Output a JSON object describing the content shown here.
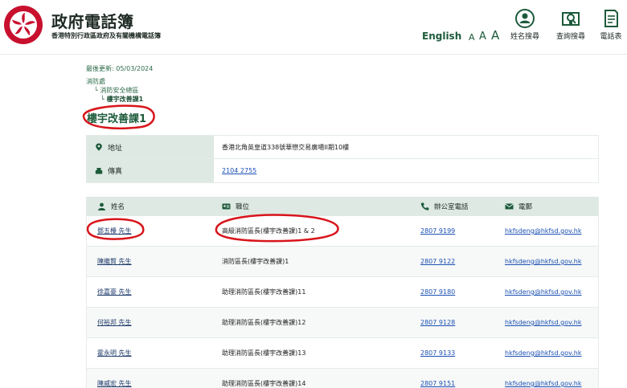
{
  "header": {
    "title": "政府電話簿",
    "subtitle": "香港特別行政區政府及有關機構電話簿",
    "language_link": "English",
    "font_sizes": [
      "A",
      "A",
      "A"
    ],
    "nav": [
      {
        "label": "姓名搜尋",
        "icon": "person-search-icon"
      },
      {
        "label": "查詢搜尋",
        "icon": "book-search-icon"
      },
      {
        "label": "電話表",
        "icon": "document-icon"
      }
    ]
  },
  "meta": {
    "last_updated": "最後更新: 05/03/2024",
    "breadcrumb": [
      "消防處",
      "└ 消防安全總區",
      "└ 樓宇改善課1"
    ]
  },
  "section_title": "樓宇改善課1",
  "info": {
    "address_label": "地址",
    "address_value": "香港北角英皇道338號華懋交易廣場II期10樓",
    "fax_label": "傳真",
    "fax_value": "2104 2755"
  },
  "staff_table": {
    "headers": {
      "name": "姓名",
      "post": "職位",
      "tel": "辦公室電話",
      "email": "電郵"
    },
    "rows": [
      {
        "name": "鄧五檯 先生",
        "post": "高級消防區長(樓宇改善課)1 & 2",
        "tel": "2807 9199",
        "email": "hkfsdeng@hkfsd.gov.hk"
      },
      {
        "name": "陳繼賢 先生",
        "post": "消防區長(樓宇改善課)1",
        "tel": "2807 9122",
        "email": "hkfsdeng@hkfsd.gov.hk"
      },
      {
        "name": "徐嘉豪 先生",
        "post": "助理消防區長(樓宇改善課)11",
        "tel": "2807 9180",
        "email": "hkfsdeng@hkfsd.gov.hk"
      },
      {
        "name": "何裕邦 先生",
        "post": "助理消防區長(樓宇改善課)12",
        "tel": "2807 9128",
        "email": "hkfsdeng@hkfsd.gov.hk"
      },
      {
        "name": "霍永明 先生",
        "post": "助理消防區長(樓宇改善課)13",
        "tel": "2807 9133",
        "email": "hkfsdeng@hkfsd.gov.hk"
      },
      {
        "name": "陳威宏 先生",
        "post": "助理消防區長(樓宇改善課)14",
        "tel": "2807 9151",
        "email": "hkfsdeng@hkfsd.gov.hk"
      }
    ]
  },
  "colors": {
    "brand_green": "#1c5a3a",
    "header_bg": "#dde9e2",
    "link": "#1a4fb3",
    "annotation_red": "#d8141b",
    "emblem_red": "#c8102e"
  }
}
